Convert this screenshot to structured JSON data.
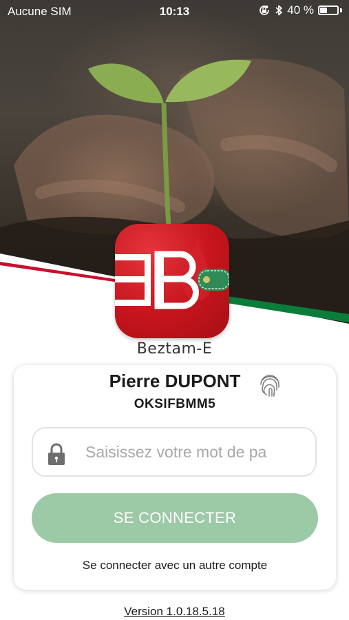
{
  "status_bar": {
    "carrier": "Aucune SIM",
    "time": "10:13",
    "battery": "40 %",
    "battery_level": 0.4,
    "icons": [
      "orientation-lock-icon",
      "bluetooth-icon",
      "battery-icon"
    ]
  },
  "brand": {
    "name": "Beztam-E",
    "logo_text": "EB",
    "logo_color": "#c5141c"
  },
  "login": {
    "user_name": "Pierre DUPONT",
    "user_id": "OKSIFBMM5",
    "password_placeholder": "Saisissez votre mot de pa",
    "connect_label": "SE CONNECTER",
    "other_account_label": "Se connecter avec un autre compte",
    "icons": [
      "fingerprint-icon",
      "lock-icon"
    ]
  },
  "footer": {
    "version": "Version 1.0.18.5.18"
  },
  "colors": {
    "accent_green": "#9cc9a6",
    "flag_red": "#c8102e",
    "flag_green": "#0a7d3b"
  }
}
